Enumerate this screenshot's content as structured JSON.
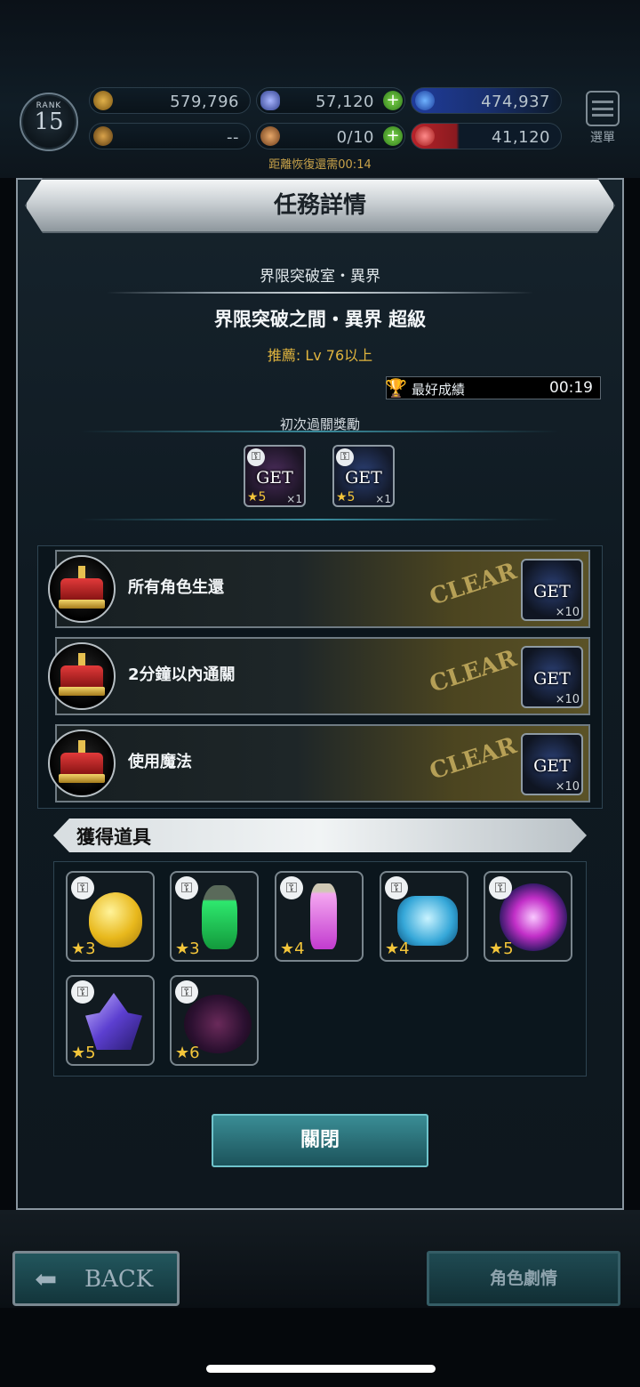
{
  "hud": {
    "rank_label": "RANK",
    "rank_value": "15",
    "gil": "579,796",
    "gems": "57,120",
    "points": "474,937",
    "trophy_value": "--",
    "stamina_items": "0/10",
    "ticket": "41,120",
    "menu_label": "選單",
    "recover_text": "距離恢復還需00:14"
  },
  "modal": {
    "title": "任務詳情",
    "subtitle": "界限突破室・異界",
    "stage_name": "界限突破之間・異界 超級",
    "recommend": "推薦: Lv 76以上",
    "best_label": "最好成績",
    "best_time": "00:19",
    "first_clear_label": "初次過關獎勵",
    "first_rewards": [
      {
        "get": "GET",
        "star": "★5",
        "qty": "×1"
      },
      {
        "get": "GET",
        "star": "★5",
        "qty": "×1"
      }
    ],
    "missions": [
      {
        "label": "所有角色生還",
        "clear": "CLEAR",
        "get": "GET",
        "qty": "×10"
      },
      {
        "label": "2分鐘以內通關",
        "clear": "CLEAR",
        "get": "GET",
        "qty": "×10"
      },
      {
        "label": "使用魔法",
        "clear": "CLEAR",
        "get": "GET",
        "qty": "×10"
      }
    ],
    "items_header": "獲得道具",
    "items": [
      {
        "star": "★3",
        "icon": "golden-apple-icon"
      },
      {
        "star": "★3",
        "icon": "green-potion-icon"
      },
      {
        "star": "★4",
        "icon": "pink-potion-icon"
      },
      {
        "star": "★4",
        "icon": "ice-crystal-box-icon"
      },
      {
        "star": "★5",
        "icon": "plasma-orb-icon"
      },
      {
        "star": "★5",
        "icon": "purple-crystal-icon"
      },
      {
        "star": "★6",
        "icon": "dark-orb-icon"
      }
    ],
    "close_label": "關閉"
  },
  "footer": {
    "back_label": "BACK",
    "story_label": "角色劇情"
  }
}
